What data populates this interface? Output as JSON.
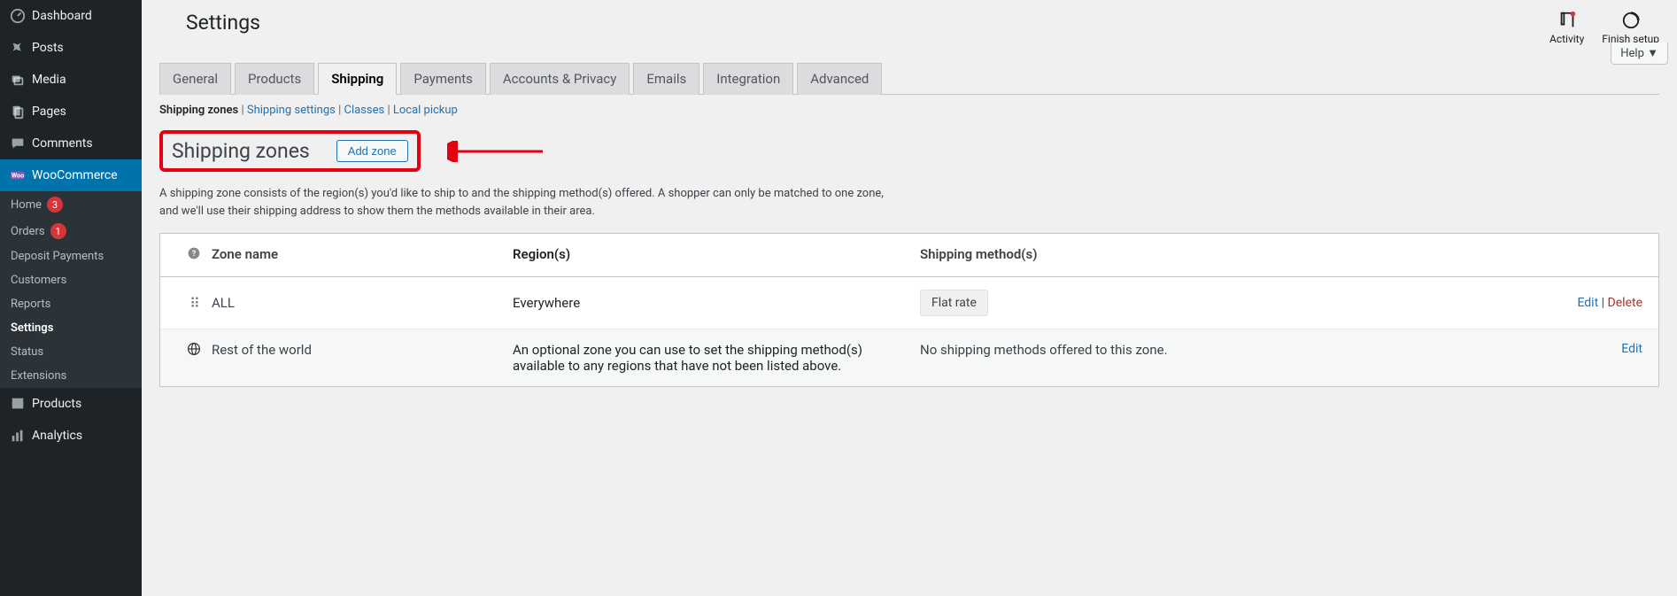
{
  "sidebar": {
    "items": [
      {
        "label": "Dashboard"
      },
      {
        "label": "Posts"
      },
      {
        "label": "Media"
      },
      {
        "label": "Pages"
      },
      {
        "label": "Comments"
      },
      {
        "label": "WooCommerce"
      },
      {
        "label": "Products"
      },
      {
        "label": "Analytics"
      }
    ],
    "sub": [
      {
        "label": "Home",
        "badge": "3"
      },
      {
        "label": "Orders",
        "badge": "1"
      },
      {
        "label": "Deposit Payments"
      },
      {
        "label": "Customers"
      },
      {
        "label": "Reports"
      },
      {
        "label": "Settings"
      },
      {
        "label": "Status"
      },
      {
        "label": "Extensions"
      }
    ]
  },
  "page": {
    "title": "Settings"
  },
  "topActions": {
    "activity": "Activity",
    "finish": "Finish setup",
    "help": "Help"
  },
  "tabs": [
    {
      "label": "General"
    },
    {
      "label": "Products"
    },
    {
      "label": "Shipping"
    },
    {
      "label": "Payments"
    },
    {
      "label": "Accounts & Privacy"
    },
    {
      "label": "Emails"
    },
    {
      "label": "Integration"
    },
    {
      "label": "Advanced"
    }
  ],
  "sublinks": {
    "zones": "Shipping zones",
    "settings": "Shipping settings",
    "classes": "Classes",
    "localpickup": "Local pickup"
  },
  "heading": {
    "title": "Shipping zones",
    "add": "Add zone"
  },
  "description": "A shipping zone consists of the region(s) you'd like to ship to and the shipping method(s) offered. A shopper can only be matched to one zone, and we'll use their shipping address to show them the methods available in their area.",
  "table": {
    "headers": {
      "name": "Zone name",
      "region": "Region(s)",
      "methods": "Shipping method(s)"
    },
    "rows": [
      {
        "name": "ALL",
        "region": "Everywhere",
        "method": "Flat rate",
        "edit": "Edit",
        "delete": "Delete"
      },
      {
        "name": "Rest of the world",
        "region": "An optional zone you can use to set the shipping method(s) available to any regions that have not been listed above.",
        "methodsText": "No shipping methods offered to this zone.",
        "edit": "Edit"
      }
    ]
  }
}
